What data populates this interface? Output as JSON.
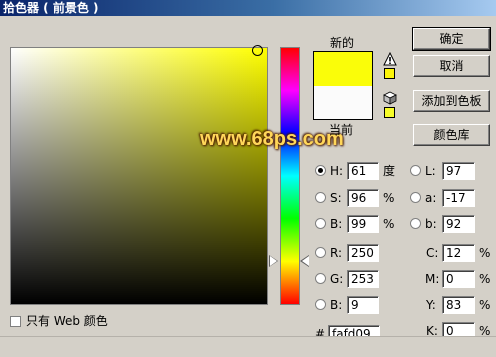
{
  "window": {
    "title": "拾色器 ( 前景色 )"
  },
  "buttons": {
    "ok": "确定",
    "cancel": "取消",
    "add_to_swatches": "添加到色板",
    "color_libraries": "颜色库"
  },
  "swatch": {
    "new_label": "新的",
    "current_label": "当前",
    "new_color": "#fafd09",
    "current_color": "#fbfbfb"
  },
  "hsb": {
    "h": {
      "label": "H:",
      "value": "61",
      "unit": "度",
      "checked": true
    },
    "s": {
      "label": "S:",
      "value": "96",
      "unit": "%"
    },
    "b": {
      "label": "B:",
      "value": "99",
      "unit": "%"
    }
  },
  "lab": {
    "l": {
      "label": "L:",
      "value": "97"
    },
    "a": {
      "label": "a:",
      "value": "-17"
    },
    "b": {
      "label": "b:",
      "value": "92"
    }
  },
  "rgb": {
    "r": {
      "label": "R:",
      "value": "250"
    },
    "g": {
      "label": "G:",
      "value": "253"
    },
    "b": {
      "label": "B:",
      "value": "9"
    }
  },
  "cmyk": {
    "c": {
      "label": "C:",
      "value": "12",
      "unit": "%"
    },
    "m": {
      "label": "M:",
      "value": "0",
      "unit": "%"
    },
    "y": {
      "label": "Y:",
      "value": "83",
      "unit": "%"
    },
    "k": {
      "label": "K:",
      "value": "0",
      "unit": "%"
    }
  },
  "hex": {
    "label": "#",
    "value": "fafd09"
  },
  "web_only": {
    "label": "只有 Web 颜色",
    "checked": false
  },
  "watermark": "www.68ps.com",
  "icons": {
    "gamut_warning": "warning-triangle-icon",
    "web_safe_warning": "cube-icon"
  },
  "colors": {
    "gamut_swatch": "#fcf40a",
    "web_swatch": "#f6fc2a"
  }
}
